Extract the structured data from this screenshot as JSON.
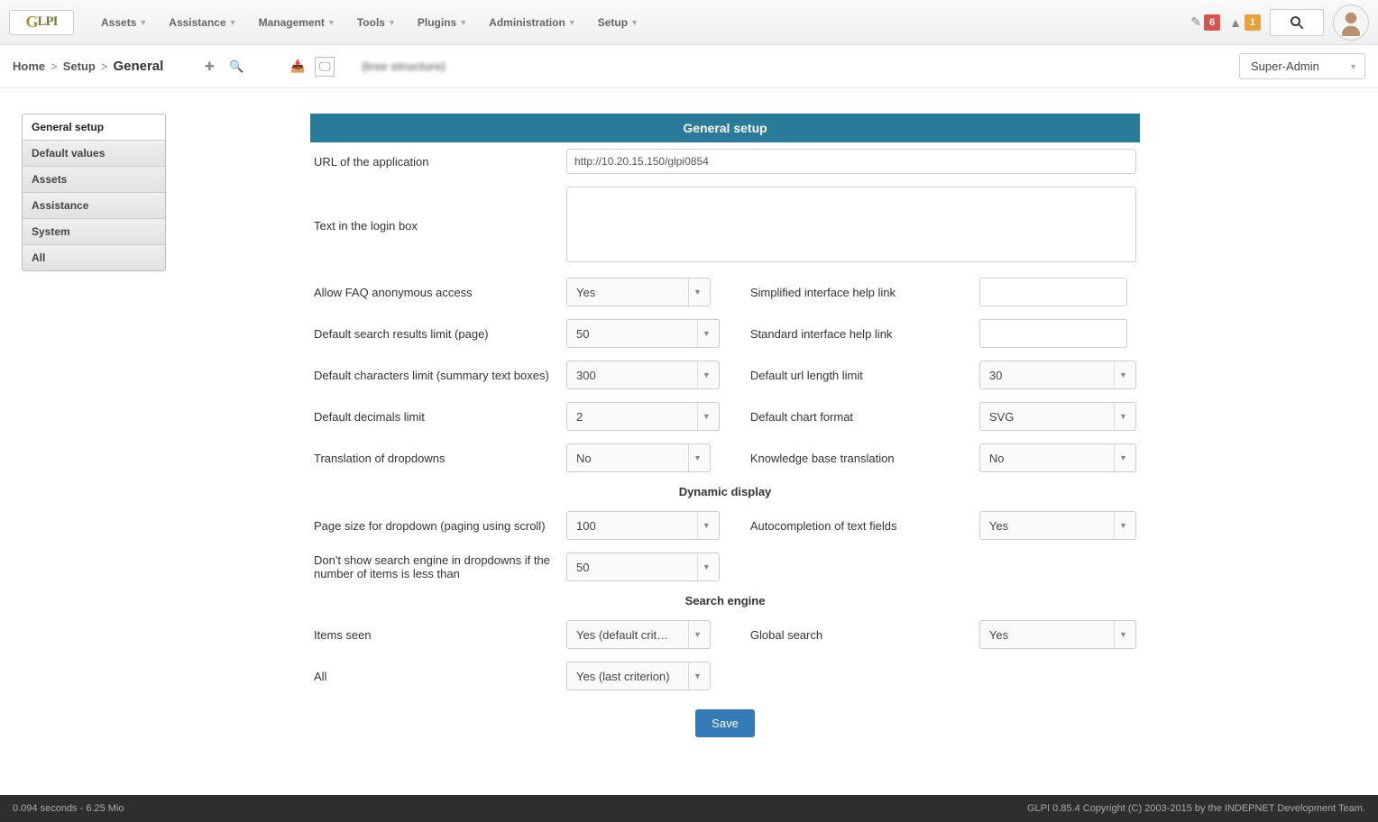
{
  "topnav": {
    "logo": "GLPI",
    "menu": [
      "Assets",
      "Assistance",
      "Management",
      "Tools",
      "Plugins",
      "Administration",
      "Setup"
    ],
    "badge1": "6",
    "badge2": "1"
  },
  "subbar": {
    "breadcrumb": [
      "Home",
      "Setup",
      "General"
    ],
    "entity": "                    (tree structure)",
    "profile": "Super-Admin"
  },
  "sidetabs": [
    "General setup",
    "Default values",
    "Assets",
    "Assistance",
    "System",
    "All"
  ],
  "form": {
    "header": "General setup",
    "url_label": "URL of the application",
    "url_value": "http://10.20.15.150/glpi0854",
    "login_text_label": "Text in the login box",
    "login_text_value": "",
    "faq_label": "Allow FAQ anonymous access",
    "faq_value": "Yes",
    "simple_help_label": "Simplified interface help link",
    "simple_help_value": "",
    "searchlimit_label": "Default search results limit (page)",
    "searchlimit_value": "50",
    "std_help_label": "Standard interface help link",
    "std_help_value": "",
    "charlimit_label": "Default characters limit (summary text boxes)",
    "charlimit_value": "300",
    "urllimit_label": "Default url length limit",
    "urllimit_value": "30",
    "decimals_label": "Default decimals limit",
    "decimals_value": "2",
    "chartfmt_label": "Default chart format",
    "chartfmt_value": "SVG",
    "trans_dd_label": "Translation of dropdowns",
    "trans_dd_value": "No",
    "kb_trans_label": "Knowledge base translation",
    "kb_trans_value": "No",
    "section_dynamic": "Dynamic display",
    "pagesize_label": "Page size for dropdown (paging using scroll)",
    "pagesize_value": "100",
    "autocomp_label": "Autocompletion of text fields",
    "autocomp_value": "Yes",
    "hidesearch_label": "Don't show search engine in dropdowns if the number of items is less than",
    "hidesearch_value": "50",
    "section_search": "Search engine",
    "items_seen_label": "Items seen",
    "items_seen_value": "Yes (default crit…",
    "global_search_label": "Global search",
    "global_search_value": "Yes",
    "all_label": "All",
    "all_value": "Yes (last criterion)",
    "save": "Save"
  },
  "footer": {
    "left": "0.094 seconds - 6.25 Mio",
    "right": "GLPI 0.85.4 Copyright (C) 2003-2015 by the INDEPNET Development Team."
  }
}
